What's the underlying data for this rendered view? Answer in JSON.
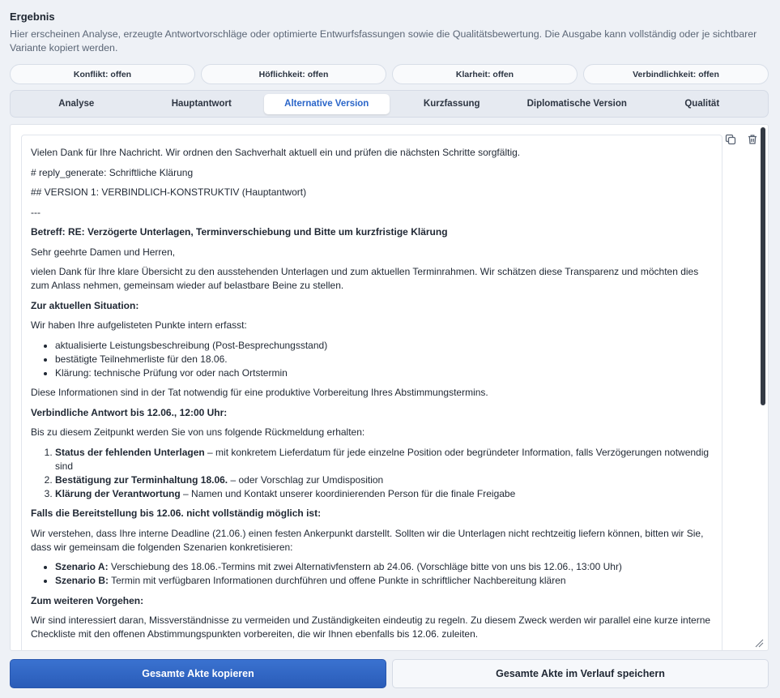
{
  "header": {
    "title": "Ergebnis",
    "description": "Hier erscheinen Analyse, erzeugte Antwortvorschläge oder optimierte Entwurfsfassungen sowie die Qualitätsbewertung. Die Ausgabe kann vollständig oder je sichtbarer Variante kopiert werden."
  },
  "badges": [
    "Konflikt: offen",
    "Höflichkeit: offen",
    "Klarheit: offen",
    "Verbindlichkeit: offen"
  ],
  "tabs": [
    {
      "label": "Analyse",
      "active": false
    },
    {
      "label": "Hauptantwort",
      "active": false
    },
    {
      "label": "Alternative Version",
      "active": true
    },
    {
      "label": "Kurzfassung",
      "active": false
    },
    {
      "label": "Diplomatische Version",
      "active": false
    },
    {
      "label": "Qualität",
      "active": false
    }
  ],
  "content": {
    "intro": "Vielen Dank für Ihre Nachricht. Wir ordnen den Sachverhalt aktuell ein und prüfen die nächsten Schritte sorgfältig.",
    "h1": "# reply_generate: Schriftliche Klärung",
    "h2": "## VERSION 1: VERBINDLICH-KONSTRUKTIV (Hauptantwort)",
    "separator": "---",
    "subject": "Betreff: RE: Verzögerte Unterlagen, Terminverschiebung und Bitte um kurzfristige Klärung",
    "salutation": "Sehr geehrte Damen und Herren,",
    "para1": "vielen Dank für Ihre klare Übersicht zu den ausstehenden Unterlagen und zum aktuellen Terminrahmen. Wir schätzen diese Transparenz und möchten dies zum Anlass nehmen, gemeinsam wieder auf belastbare Beine zu stellen.",
    "sec1": "Zur aktuellen Situation:",
    "sec1_text": "Wir haben Ihre aufgelisteten Punkte intern erfasst:",
    "sec1_items": [
      "aktualisierte Leistungsbeschreibung (Post-Besprechungsstand)",
      "bestätigte Teilnehmerliste für den 18.06.",
      "Klärung: technische Prüfung vor oder nach Ortstermin"
    ],
    "sec1_after": "Diese Informationen sind in der Tat notwendig für eine produktive Vorbereitung Ihres Abstimmungstermins.",
    "sec2": "Verbindliche Antwort bis 12.06., 12:00 Uhr:",
    "sec2_text": "Bis zu diesem Zeitpunkt werden Sie von uns folgende Rückmeldung erhalten:",
    "sec2_items": [
      {
        "bold": "Status der fehlenden Unterlagen",
        "rest": " – mit konkretem Lieferdatum für jede einzelne Position oder begründeter Information, falls Verzögerungen notwendig sind"
      },
      {
        "bold": "Bestätigung zur Terminhaltung 18.06.",
        "rest": " – oder Vorschlag zur Umdisposition"
      },
      {
        "bold": "Klärung der Verantwortung",
        "rest": " – Namen und Kontakt unserer koordinierenden Person für die finale Freigabe"
      }
    ],
    "sec3": "Falls die Bereitstellung bis 12.06. nicht vollständig möglich ist:",
    "sec3_text": "Wir verstehen, dass Ihre interne Deadline (21.06.) einen festen Ankerpunkt darstellt. Sollten wir die Unterlagen nicht rechtzeitig liefern können, bitten wir Sie, dass wir gemeinsam die folgenden Szenarien konkretisieren:",
    "sec3_items": [
      {
        "bold": "Szenario A:",
        "rest": " Verschiebung des 18.06.-Termins mit zwei Alternativfenstern ab 24.06. (Vorschläge bitte von uns bis 12.06., 13:00 Uhr)"
      },
      {
        "bold": "Szenario B:",
        "rest": " Termin mit verfügbaren Informationen durchführen und offene Punkte in schriftlicher Nachbereitung klären"
      }
    ],
    "sec4": "Zum weiteren Vorgehen:",
    "sec4_text": "Wir sind interessiert daran, Missverständnisse zu vermeiden und Zuständigkeiten eindeutig zu regeln. Zu diesem Zweck werden wir parallel eine kurze interne Checkliste mit den offenen Abstimmungspunkten vorbereiten, die wir Ihnen ebenfalls bis 12.06. zuleiten."
  },
  "icons": {
    "copy": "copy-icon",
    "delete": "trash-icon",
    "resize": "resize-handle-icon"
  },
  "buttons": {
    "copy_all": "Gesamte Akte kopieren",
    "save_history": "Gesamte Akte im Verlauf speichern"
  },
  "colors": {
    "accent": "#2b66c9",
    "primary_button": "#2f63c0",
    "background": "#eef1f6"
  }
}
